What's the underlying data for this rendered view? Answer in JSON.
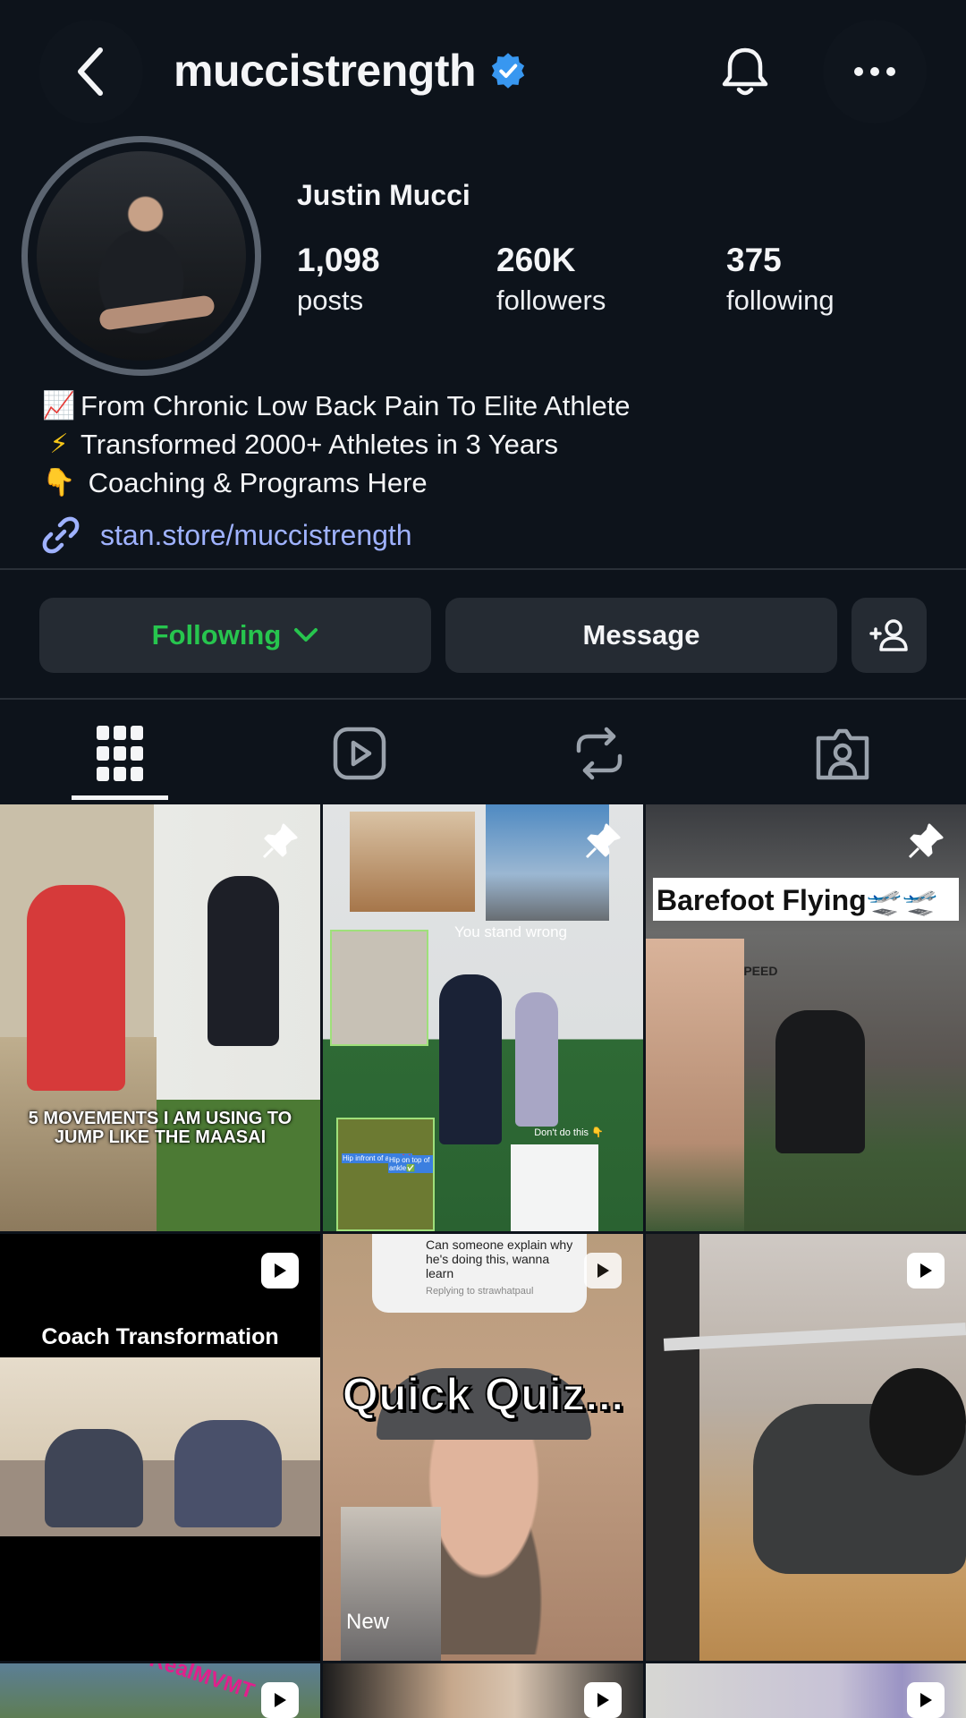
{
  "header": {
    "username": "muccistrength",
    "back_icon": "chevron-left-icon",
    "verified_icon": "verified-badge-icon",
    "bell_icon": "bell-icon",
    "more_icon": "more-horizontal-icon"
  },
  "profile": {
    "display_name": "Justin Mucci",
    "stats": [
      {
        "num": "1,098",
        "label": "posts"
      },
      {
        "num": "260K",
        "label": "followers"
      },
      {
        "num": "375",
        "label": "following"
      }
    ],
    "bio": [
      {
        "emoji": "📈",
        "text": "From Chronic Low Back Pain To Elite Athlete"
      },
      {
        "emoji": "⚡",
        "text": "Transformed 2000+ Athletes in 3 Years"
      },
      {
        "emoji": "👇",
        "text": " Coaching & Programs Here"
      }
    ],
    "link": "stan.store/muccistrength",
    "link_color": "#9fb2ff"
  },
  "actions": {
    "following_label": "Following",
    "message_label": "Message",
    "following_color": "#27c54e"
  },
  "tabs": [
    {
      "name": "posts-grid",
      "icon": "grid-icon",
      "active": true
    },
    {
      "name": "reels",
      "icon": "reels-icon",
      "active": false
    },
    {
      "name": "reposts",
      "icon": "repost-icon",
      "active": false
    },
    {
      "name": "tagged",
      "icon": "tagged-icon",
      "active": false
    }
  ],
  "posts": [
    {
      "caption": "5 MOVEMENTS I AM USING TO JUMP LIKE THE MAASAI",
      "badge": "pin-icon"
    },
    {
      "caption": "You stand wrong",
      "sub1": "Don't do this 👇",
      "label_a": "Hip infront of ankle❌",
      "label_b": "Hip on top of ankle✅",
      "badge": "pin-icon"
    },
    {
      "caption": "Barefoot Flying🛫🛫",
      "wall": "SPEED",
      "badge": "pin-icon"
    },
    {
      "caption": "Coach Transformation",
      "badge": "reel-icon"
    },
    {
      "caption": "Quick Quiz...",
      "comment": "Can someone explain why he's doing this, wanna learn",
      "reply": "Replying to strawhatpaul",
      "new": "New",
      "badge": "reel-icon"
    },
    {
      "caption": "",
      "badge": "reel-icon"
    },
    {
      "caption": "RealMVMT",
      "badge": "reel-icon"
    },
    {
      "caption": "",
      "badge": "reel-icon"
    },
    {
      "caption": "",
      "badge": "reel-icon"
    }
  ]
}
